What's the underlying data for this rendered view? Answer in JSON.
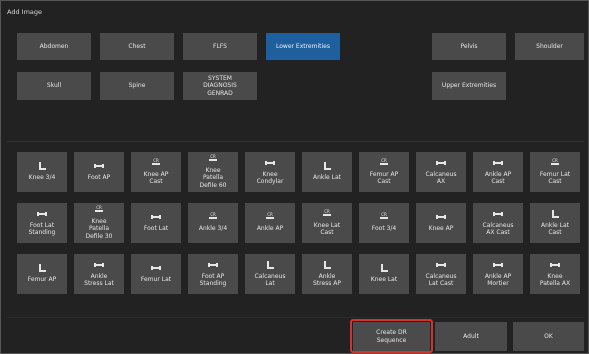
{
  "window": {
    "title": "Add Image"
  },
  "categories": [
    {
      "label": "Abdomen",
      "selected": false
    },
    {
      "label": "Chest",
      "selected": false
    },
    {
      "label": "FLFS",
      "selected": false
    },
    {
      "label": "Lower Extremities",
      "selected": true
    },
    {
      "label": "Pelvis",
      "selected": false
    },
    {
      "label": "Shoulder",
      "selected": false
    },
    {
      "label": "Skull",
      "selected": false
    },
    {
      "label": "Spine",
      "selected": false
    },
    {
      "label": "SYSTEM\nDIAGNOSIS\nGENRAD",
      "selected": false
    },
    {
      "label": "Upper Extremities",
      "selected": false
    }
  ],
  "views": [
    {
      "label": "Knee 3/4",
      "icon": "lateral-icon"
    },
    {
      "label": "Foot AP",
      "icon": "table-icon"
    },
    {
      "label": "Knee AP\nCast",
      "icon": "cr-icon"
    },
    {
      "label": "Knee\nPatella\nDefile 60",
      "icon": "cr-icon"
    },
    {
      "label": "Knee\nCondylar",
      "icon": "table-icon"
    },
    {
      "label": "Ankle Lat",
      "icon": "lateral-icon"
    },
    {
      "label": "Femur AP\nCast",
      "icon": "cr-icon"
    },
    {
      "label": "Calcaneus\nAX",
      "icon": "table-icon"
    },
    {
      "label": "Ankle AP\nCast",
      "icon": "table-icon"
    },
    {
      "label": "Femur Lat\nCast",
      "icon": "cr-icon"
    },
    {
      "label": "Foot Lat\nStanding",
      "icon": "table-icon"
    },
    {
      "label": "Knee\nPatella\nDefile 30",
      "icon": "cr-icon"
    },
    {
      "label": "Foot Lat",
      "icon": "table-icon"
    },
    {
      "label": "Ankle 3/4",
      "icon": "cr-icon"
    },
    {
      "label": "Ankle AP",
      "icon": "cr-icon"
    },
    {
      "label": "Knee Lat\nCast",
      "icon": "cr-icon"
    },
    {
      "label": "Foot 3/4",
      "icon": "cr-icon"
    },
    {
      "label": "Knee AP",
      "icon": "table-icon"
    },
    {
      "label": "Calcaneus\nAX Cast",
      "icon": "table-icon"
    },
    {
      "label": "Ankle Lat\nCast",
      "icon": "lateral-icon"
    },
    {
      "label": "Femur AP",
      "icon": "lateral-icon"
    },
    {
      "label": "Ankle\nStress Lat",
      "icon": "table-icon"
    },
    {
      "label": "Femur Lat",
      "icon": "table-icon"
    },
    {
      "label": "Foot AP\nStanding",
      "icon": "table-icon"
    },
    {
      "label": "Calcaneus\nLat",
      "icon": "lateral-icon"
    },
    {
      "label": "Ankle\nStress AP",
      "icon": "lateral-icon"
    },
    {
      "label": "Knee Lat",
      "icon": "lateral-icon"
    },
    {
      "label": "Calcaneus\nLat Cast",
      "icon": "table-icon"
    },
    {
      "label": "Ankle AP\nMortier",
      "icon": "table-icon"
    },
    {
      "label": "Knee\nPatella AX",
      "icon": "table-icon"
    }
  ],
  "footer": {
    "create_dr_sequence": "Create DR\nSequence",
    "adult": "Adult",
    "ok": "OK",
    "highlight_color": "#d43232"
  }
}
